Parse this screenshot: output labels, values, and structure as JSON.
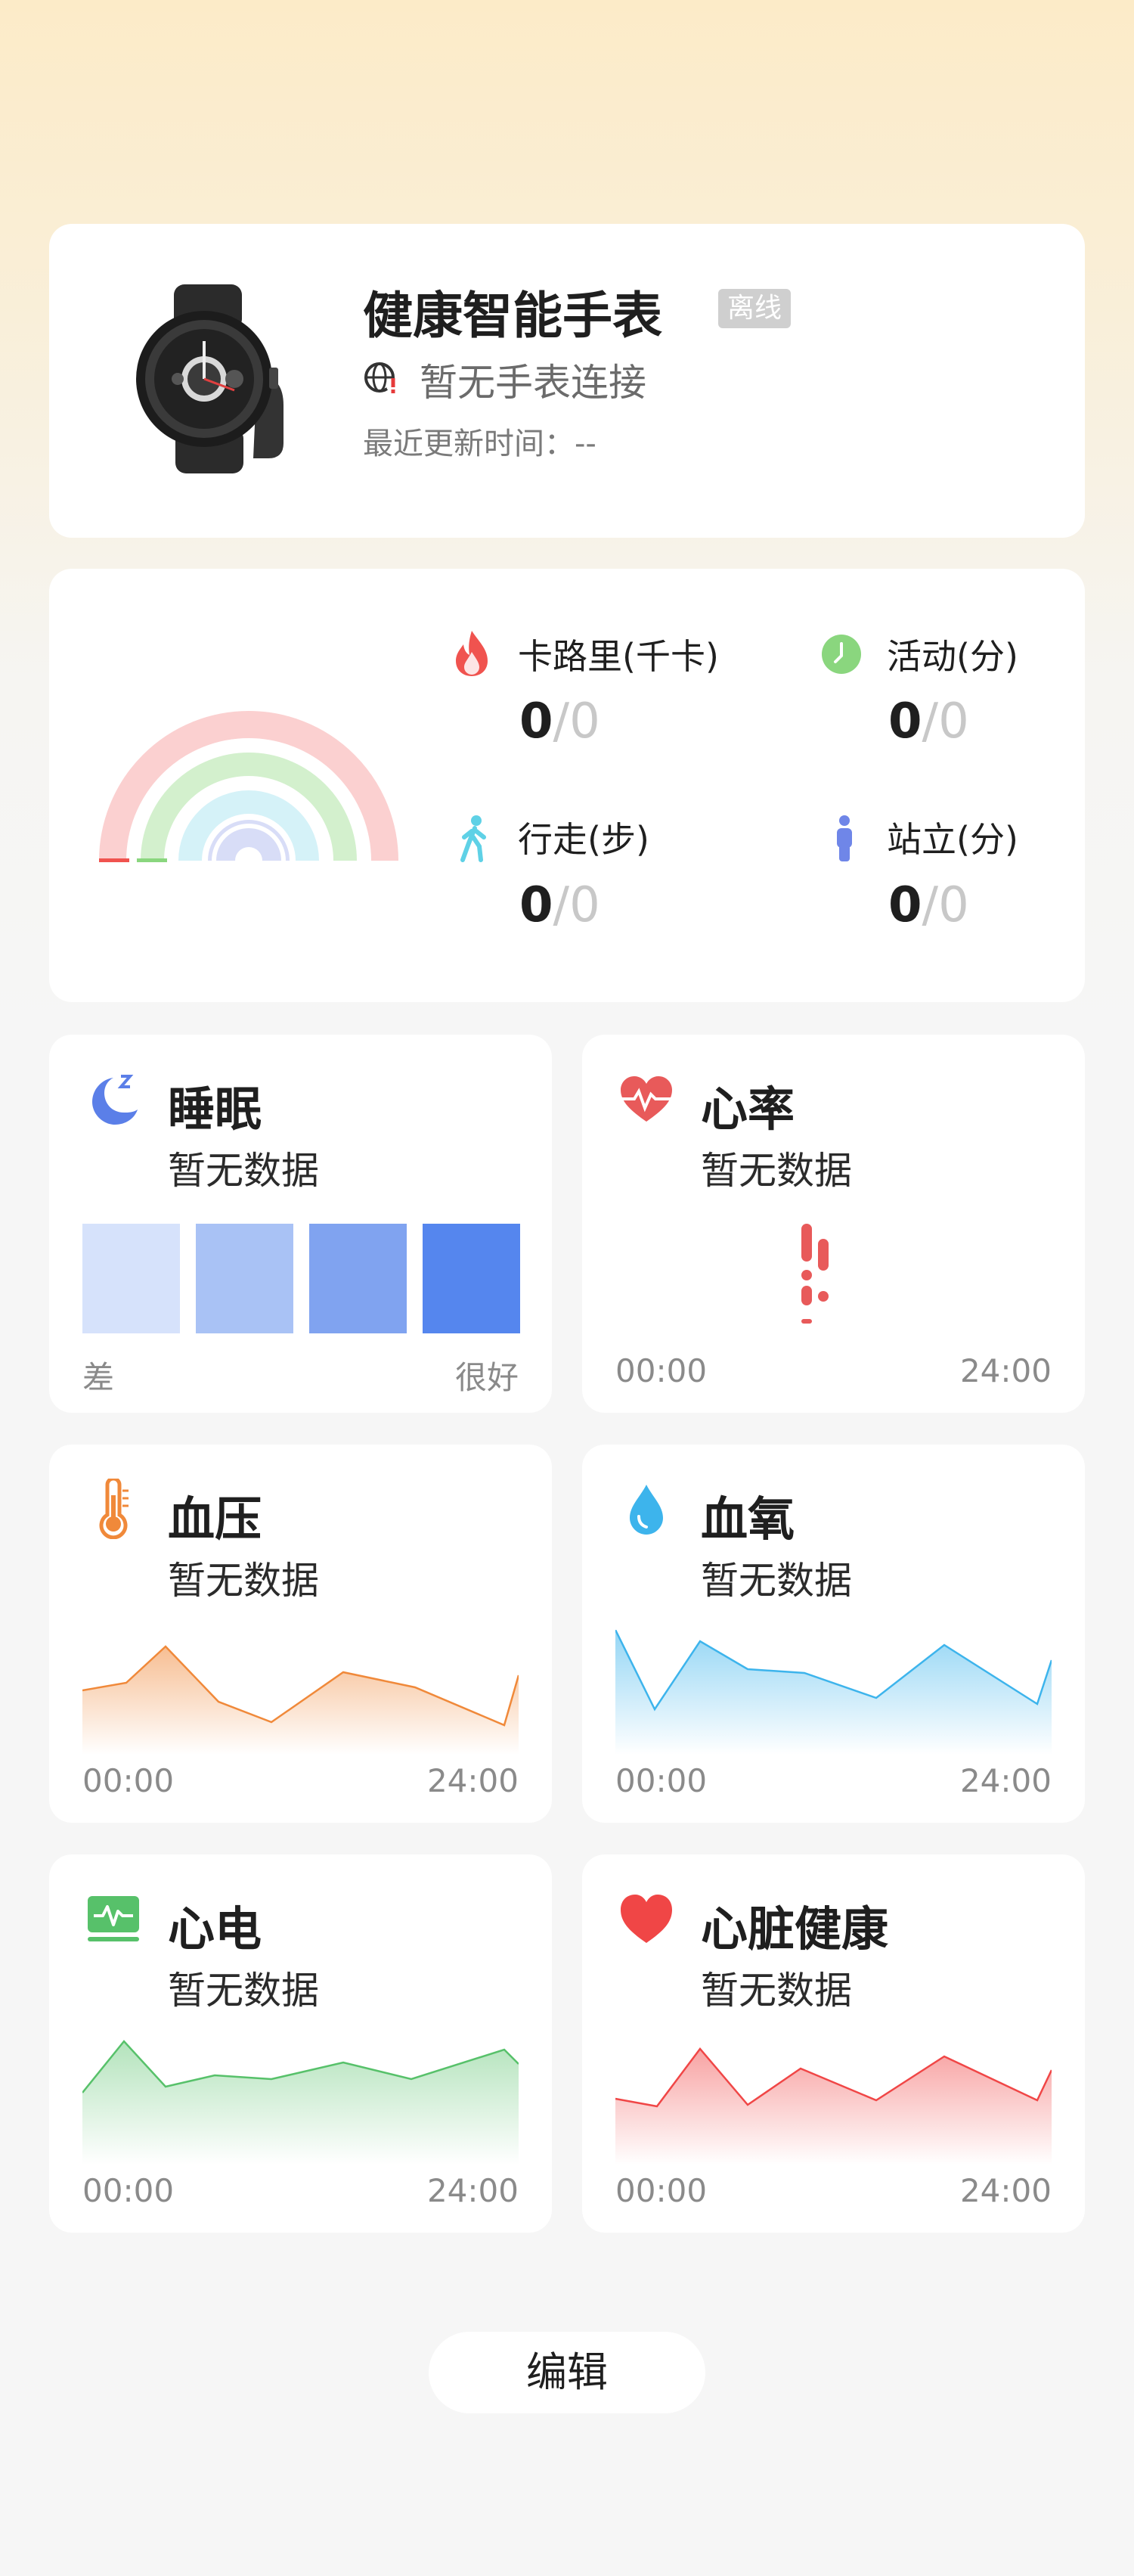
{
  "device": {
    "name": "健康智能手表",
    "status_badge": "离线",
    "connection_text": "暂无手表连接",
    "update_time": "最近更新时间：--"
  },
  "activity": {
    "calories": {
      "label": "卡路里(千卡)",
      "value": "0",
      "goal": "0",
      "color": "#f0534f",
      "icon": "flame-icon"
    },
    "active": {
      "label": "活动(分)",
      "value": "0",
      "goal": "0",
      "color": "#8ad67e",
      "icon": "clock-icon"
    },
    "walk": {
      "label": "行走(步)",
      "value": "0",
      "goal": "0",
      "color": "#5fd1e6",
      "icon": "walking-icon"
    },
    "stand": {
      "label": "站立(分)",
      "value": "0",
      "goal": "0",
      "color": "#6f86e8",
      "icon": "standing-icon"
    },
    "separator": "/"
  },
  "metrics": {
    "sleep": {
      "title": "睡眠",
      "subtitle": "暂无数据",
      "axis_left": "差",
      "axis_right": "很好",
      "icon": "moon-icon",
      "color": "#5b7fe8"
    },
    "heart_rate": {
      "title": "心率",
      "subtitle": "暂无数据",
      "axis_left": "00:00",
      "axis_right": "24:00",
      "icon": "heart-pulse-icon",
      "color": "#e85a5a"
    },
    "blood_pressure": {
      "title": "血压",
      "subtitle": "暂无数据",
      "axis_left": "00:00",
      "axis_right": "24:00",
      "icon": "thermometer-icon",
      "color": "#f0893a"
    },
    "blood_oxygen": {
      "title": "血氧",
      "subtitle": "暂无数据",
      "axis_left": "00:00",
      "axis_right": "24:00",
      "icon": "water-drop-icon",
      "color": "#3db4ec"
    },
    "ecg": {
      "title": "心电",
      "subtitle": "暂无数据",
      "axis_left": "00:00",
      "axis_right": "24:00",
      "icon": "ecg-monitor-icon",
      "color": "#57c16a"
    },
    "heart_health": {
      "title": "心脏健康",
      "subtitle": "暂无数据",
      "axis_left": "00:00",
      "axis_right": "24:00",
      "icon": "heart-icon",
      "color": "#f04646"
    }
  },
  "edit_button": "编辑"
}
